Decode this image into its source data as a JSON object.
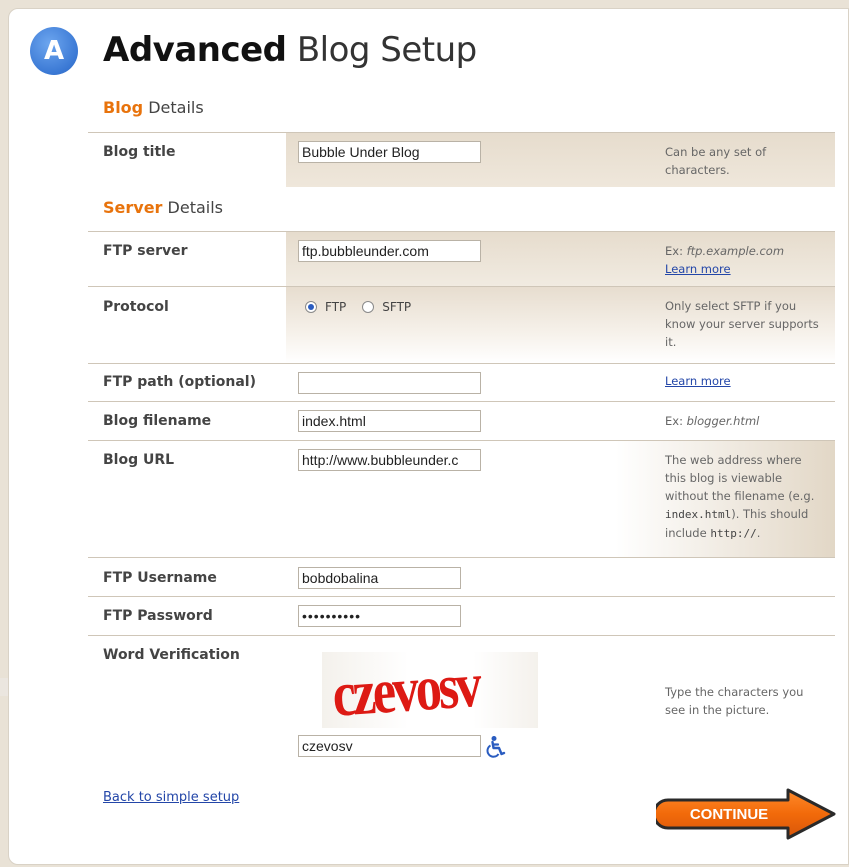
{
  "header": {
    "badge_letter": "A",
    "title_strong": "Advanced",
    "title_rest": " Blog Setup"
  },
  "sections": {
    "blog": {
      "accent": "Blog",
      "rest": " Details"
    },
    "server": {
      "accent": "Server",
      "rest": " Details"
    }
  },
  "fields": {
    "blog_title": {
      "label": "Blog title",
      "value": "Bubble Under Blog",
      "hint": "Can be any set of characters."
    },
    "ftp_server": {
      "label": "FTP server",
      "value": "ftp.bubbleunder.com",
      "hint_prefix": "Ex: ",
      "hint_example": "ftp.example.com",
      "learn_more": "Learn more"
    },
    "protocol": {
      "label": "Protocol",
      "options": [
        "FTP",
        "SFTP"
      ],
      "selected": "FTP",
      "hint": "Only select SFTP if you know your server supports it."
    },
    "ftp_path": {
      "label": "FTP path (optional)",
      "value": "",
      "learn_more": "Learn more"
    },
    "blog_filename": {
      "label": "Blog filename",
      "value": "index.html",
      "hint_prefix": "Ex: ",
      "hint_example": "blogger.html"
    },
    "blog_url": {
      "label": "Blog URL",
      "value": "http://www.bubbleunder.c",
      "hint_1": "The web address where this blog is viewable without the filename (e.g. ",
      "hint_code_1": "index.html",
      "hint_2": "). This should include ",
      "hint_code_2": "http://",
      "hint_3": "."
    },
    "ftp_username": {
      "label": "FTP Username",
      "value": "bobdobalina"
    },
    "ftp_password": {
      "label": "FTP Password",
      "value": "••••••••••"
    },
    "word_verification": {
      "label": "Word Verification",
      "captcha_text": "czevosv",
      "value": "czevosv",
      "hint": "Type the characters you see in the picture."
    }
  },
  "footer": {
    "back_link": "Back to simple setup",
    "continue_label": "CONTINUE"
  },
  "colors": {
    "accent_orange": "#e8730c",
    "link_blue": "#2346a8",
    "badge_blue": "#3a78d4",
    "captcha_red": "#dd1a14"
  }
}
